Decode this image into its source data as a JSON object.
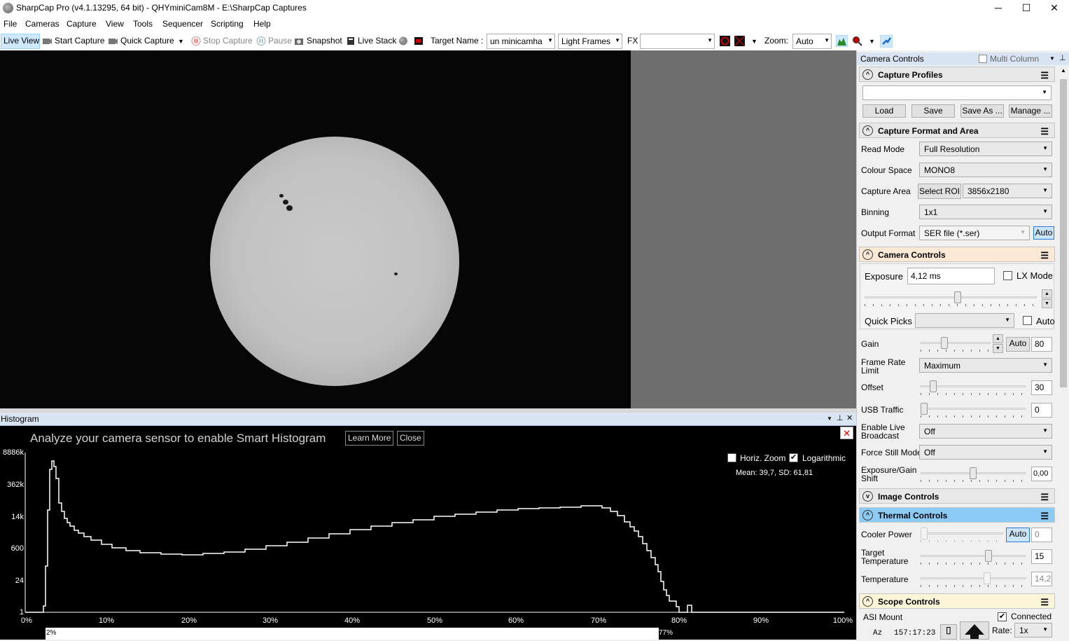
{
  "window": {
    "title": "SharpCap Pro (v4.1.13295, 64 bit) - QHYminiCam8M - E:\\SharpCap Captures",
    "minimize": "─",
    "maximize": "☐",
    "close": "✕"
  },
  "menu": [
    "File",
    "Cameras",
    "Capture",
    "View",
    "Tools",
    "Sequencer",
    "Scripting",
    "Help"
  ],
  "toolbar": {
    "live_view": "Live View",
    "start_capture": "Start Capture",
    "quick_capture": "Quick Capture",
    "stop_capture": "Stop Capture",
    "pause": "Pause",
    "snapshot": "Snapshot",
    "live_stack": "Live Stack",
    "target_name_label": "Target Name :",
    "target_name_value": "un minicamha",
    "frame_type": "Light Frames",
    "fx_label": "FX",
    "fx_value": "",
    "zoom_label": "Zoom:",
    "zoom_value": "Auto"
  },
  "histogram": {
    "panel_title": "Histogram",
    "banner": "Analyze your camera sensor to enable Smart Histogram",
    "learn_more": "Learn More",
    "close": "Close",
    "horiz_zoom": "Horiz. Zoom",
    "horiz_zoom_checked": false,
    "logarithmic": "Logarithmic",
    "logarithmic_checked": true,
    "stats": "Mean: 39,7, SD: 61,81",
    "y_ticks": [
      "8886k",
      "362k",
      "14k",
      "600",
      "24",
      "1"
    ],
    "x_ticks": [
      "0%",
      "10%",
      "20%",
      "30%",
      "40%",
      "50%",
      "60%",
      "70%",
      "80%",
      "90%",
      "100%"
    ],
    "black_point": "2%",
    "white_point": "77%"
  },
  "camera_controls": {
    "header": "Camera Controls",
    "multi_column": "Multi Column",
    "capture_profiles": {
      "title": "Capture Profiles",
      "selected": "",
      "load": "Load",
      "save": "Save",
      "save_as": "Save As ...",
      "manage": "Manage ..."
    },
    "capture_format": {
      "title": "Capture Format and Area",
      "read_mode_label": "Read Mode",
      "read_mode": "Full Resolution",
      "colour_space_label": "Colour Space",
      "colour_space": "MONO8",
      "capture_area_label": "Capture Area",
      "select_roi": "Select ROI",
      "capture_area": "3856x2180",
      "binning_label": "Binning",
      "binning": "1x1",
      "output_format_label": "Output Format",
      "output_format": "SER file (*.ser)",
      "auto": "Auto"
    },
    "controls": {
      "title": "Camera Controls",
      "exposure_label": "Exposure",
      "exposure": "4,12 ms",
      "lx_mode": "LX Mode",
      "quick_picks_label": "Quick Picks",
      "quick_picks": "",
      "auto": "Auto",
      "gain_label": "Gain",
      "gain_auto": "Auto",
      "gain": "80",
      "frame_rate_label": "Frame Rate Limit",
      "frame_rate": "Maximum",
      "offset_label": "Offset",
      "offset": "30",
      "usb_label": "USB Traffic",
      "usb": "0",
      "live_broadcast_label": "Enable Live Broadcast",
      "live_broadcast": "Off",
      "force_still_label": "Force Still Mode",
      "force_still": "Off",
      "exposure_gain_shift_label": "Exposure/Gain Shift",
      "exposure_gain_shift": "0,00"
    },
    "image_controls": {
      "title": "Image Controls"
    },
    "thermal": {
      "title": "Thermal Controls",
      "cooler_power_label": "Cooler Power",
      "cooler_auto": "Auto",
      "cooler_power": "0",
      "target_temp_label": "Target Temperature",
      "target_temp": "15",
      "temperature_label": "Temperature",
      "temperature": "14,2"
    },
    "scope": {
      "title": "Scope Controls",
      "mount": "ASI Mount",
      "connected": "Connected",
      "az_label": "Az",
      "az_value": "157:17:23",
      "rate_label": "Rate:",
      "rate": "1x"
    }
  },
  "colors": {
    "thermal_header": "#8ccbf5",
    "camera_controls_header": "#fbe9d6",
    "scope_header": "#fdf5d8",
    "default_header": "#e8e8e8"
  }
}
